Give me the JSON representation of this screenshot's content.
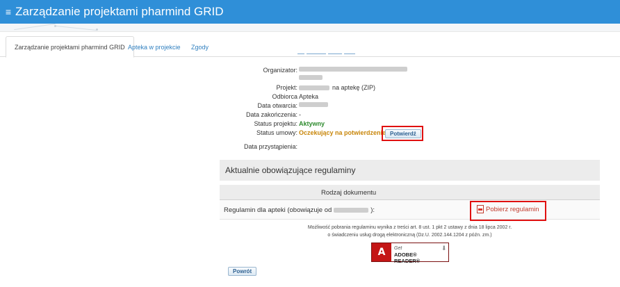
{
  "header": {
    "menu_icon": "hamburger-icon",
    "title": "Zarządzanie projektami pharmind GRID",
    "bg_color": "#2f8fd8"
  },
  "tabs": [
    {
      "label": "Zarządzanie projektami pharmind GRID",
      "active": true
    },
    {
      "label": "Apteka w projekcie",
      "active": false
    },
    {
      "label": "Zgody",
      "active": false
    }
  ],
  "details": {
    "organizer_label": "Organizator:",
    "project_label": "Projekt:",
    "project_value_suffix": "na aptekę (ZIP)",
    "recipient_label": "Odbiorca",
    "recipient_value": "Apteka",
    "open_date_label": "Data otwarcia:",
    "close_date_label": "Data zakończenia:",
    "close_date_value": "-",
    "project_status_label": "Status projektu:",
    "project_status_value": "Aktywny",
    "contract_status_label": "Status umowy:",
    "contract_status_value": "Oczekujący na potwierdzenie",
    "confirm_button": "Potwierdź",
    "join_date_label": "Data przystąpienia:"
  },
  "regulations": {
    "section_title": "Aktualnie obowiązujące regulaminy",
    "column_header": "Rodzaj dokumentu",
    "row_label_prefix": "Regulamin dla apteki (obowiązuje od",
    "row_label_suffix": "):",
    "download_link": "Pobierz regulamin",
    "note_line1": "Możliwość pobrania regulaminu wynika z treści art. 8 ust. 1 pkt 2 ustawy z dnia 18 lipca 2002 r.",
    "note_line2": "o świadczeniu usług drogą elektroniczną (Dz.U. 2002.144.1204 z późn. zm.)"
  },
  "adobe_badge": {
    "get": "Get",
    "name": "ADOBE® READER®"
  },
  "back_button": "Powrót"
}
